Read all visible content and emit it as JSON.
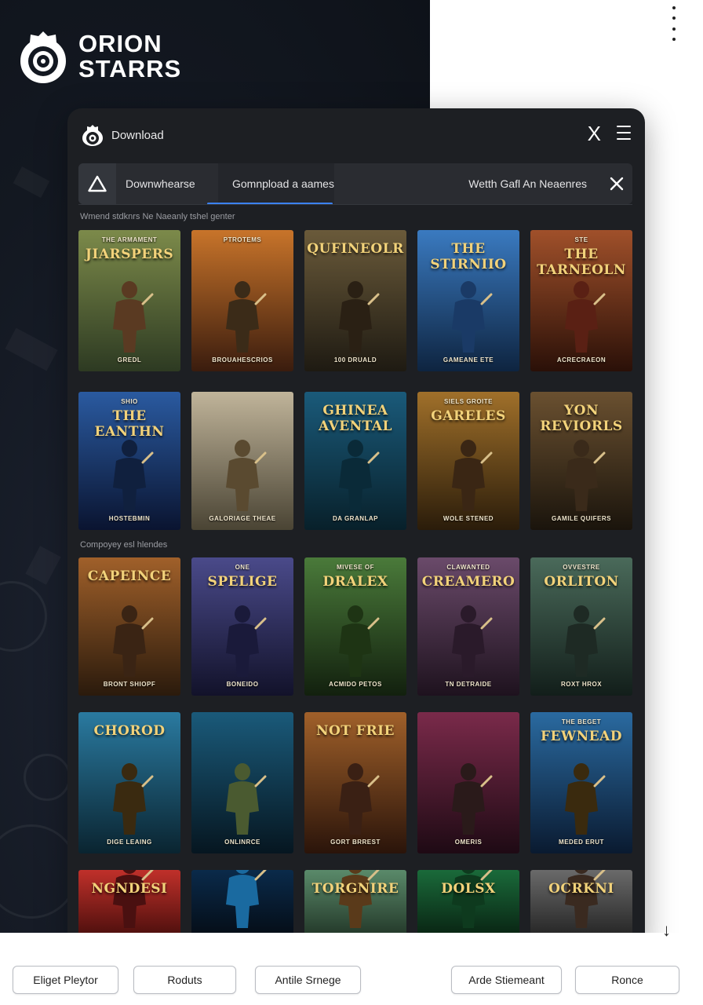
{
  "brand": {
    "line1": "ORION",
    "line2": "STARRS"
  },
  "window": {
    "title": "Download",
    "close_glyph": "X",
    "tabs": [
      {
        "label": "Downwhearse",
        "active": false
      },
      {
        "label": "Gomnpload a aames",
        "active": true
      },
      {
        "label": "Wetth Gafl An Neaenres",
        "active": false
      }
    ]
  },
  "sections": [
    {
      "label": "Wmend stdknrs  Ne Naeanly tshel genter"
    },
    {
      "label": "Compoyey esl hlendes"
    }
  ],
  "games": [
    [
      {
        "title": "JIARSPERS",
        "top": "THE ARMAMENT",
        "sub": "GREDL",
        "bg": [
          "#7c8a4a",
          "#2d3a22"
        ],
        "fig": "#5a3a22"
      },
      {
        "title": "",
        "top": "PTROTEMS",
        "sub": "BROUAHESCRIOS",
        "bg": [
          "#c8742a",
          "#3a1c0e"
        ],
        "fig": "#3b2b18"
      },
      {
        "title": "QUFINEOLR",
        "top": "",
        "sub": "100 DRUALD",
        "bg": [
          "#6a5a3a",
          "#1e1a12"
        ],
        "fig": "#2a2014"
      },
      {
        "title": "THE STIRNIIO",
        "top": "",
        "sub": "GAMEANE ETE",
        "bg": [
          "#3a7ac0",
          "#0e2440"
        ],
        "fig": "#1a3a66"
      },
      {
        "title": "THE TARNEOLN",
        "top": "STE",
        "sub": "ACRECRAEON",
        "bg": [
          "#a0502a",
          "#2a1008"
        ],
        "fig": "#5a2014"
      }
    ],
    [
      {
        "title": "THE EANTHN",
        "top": "SHIO",
        "sub": "HOSTEBMIN",
        "bg": [
          "#2a5aa0",
          "#0a1430"
        ],
        "fig": "#10203e"
      },
      {
        "title": "",
        "top": "",
        "sub": "GALORIAGE THEAE",
        "bg": [
          "#c0b49a",
          "#4a4434"
        ],
        "fig": "#5a4a30"
      },
      {
        "title": "GHINEA AVENTAL",
        "top": "",
        "sub": "DA GRANLAP",
        "bg": [
          "#1a5a7a",
          "#08202a"
        ],
        "fig": "#0a2a38"
      },
      {
        "title": "GARELES",
        "top": "SIELS GROITE",
        "sub": "WOLE STENED",
        "bg": [
          "#a0702a",
          "#2a1c0a"
        ],
        "fig": "#3a2614"
      },
      {
        "title": "YON REVIORLS",
        "top": "",
        "sub": "GAMILE QUIFERS",
        "bg": [
          "#6a5030",
          "#1a140c"
        ],
        "fig": "#3a2a1a"
      }
    ],
    [
      {
        "title": "CAPEINCE",
        "top": "",
        "sub": "BRONT SHIOPF",
        "bg": [
          "#a0602a",
          "#2a1a0c"
        ],
        "fig": "#3a2414"
      },
      {
        "title": "SPELIGE",
        "top": "ONE",
        "sub": "BONEIDO",
        "bg": [
          "#4a4a8a",
          "#12122a"
        ],
        "fig": "#1a1a3a"
      },
      {
        "title": "DRALEX",
        "top": "MIVESE OF",
        "sub": "ACMIDO PETOS",
        "bg": [
          "#4a7a3a",
          "#12200e"
        ],
        "fig": "#1e3414"
      },
      {
        "title": "CREAMERO",
        "top": "CLAWANTED",
        "sub": "TN DETRAIDE",
        "bg": [
          "#6a4a6a",
          "#1e121e"
        ],
        "fig": "#2a1a2a"
      },
      {
        "title": "ORLITON",
        "top": "OVVESTRE",
        "sub": "ROXT HROX",
        "bg": [
          "#4a6a5a",
          "#121e1a"
        ],
        "fig": "#1e2a24"
      }
    ],
    [
      {
        "title": "CHOROD",
        "top": "",
        "sub": "DIGE LEAING",
        "bg": [
          "#2a7aa0",
          "#0a2430"
        ],
        "fig": "#3a2a10"
      },
      {
        "title": "",
        "top": "",
        "sub": "ONLINRCE",
        "bg": [
          "#1a5a7a",
          "#061620"
        ],
        "fig": "#4a5a30"
      },
      {
        "title": "NOT FRIE",
        "top": "",
        "sub": "GORT BRREST",
        "bg": [
          "#a0602a",
          "#2a140a"
        ],
        "fig": "#3a2014"
      },
      {
        "title": "",
        "top": "",
        "sub": "OMERIS",
        "bg": [
          "#7a2a4a",
          "#1e0a14"
        ],
        "fig": "#2a1a1a"
      },
      {
        "title": "FEWNEAD",
        "top": "THE BEGET",
        "sub": "MEDED ERUT",
        "bg": [
          "#2a6aa0",
          "#0a1a30"
        ],
        "fig": "#3a2a0e"
      }
    ],
    [
      {
        "title": "NGNDESI",
        "top": "",
        "sub": "",
        "bg": [
          "#c0302a",
          "#3a0a08"
        ],
        "fig": "#4a1010"
      },
      {
        "title": "",
        "top": "",
        "sub": "",
        "bg": [
          "#0a2a4a",
          "#04080e"
        ],
        "fig": "#1a6aa0"
      },
      {
        "title": "TORGNIRE",
        "top": "",
        "sub": "",
        "bg": [
          "#5a8a6a",
          "#1a2a1e"
        ],
        "fig": "#5a3a1a"
      },
      {
        "title": "DOLSX",
        "top": "",
        "sub": "",
        "bg": [
          "#1a6a3a",
          "#06180c"
        ],
        "fig": "#0e3a1e"
      },
      {
        "title": "OCRKNI",
        "top": "",
        "sub": "",
        "bg": [
          "#6a6a6a",
          "#1a1a1a"
        ],
        "fig": "#3a2a20"
      }
    ]
  ],
  "bottom_buttons": [
    "Eliget Pleytor",
    "Roduts",
    "Antile Srnege",
    "Arde Stiemeant",
    "Ronce"
  ],
  "colors": {
    "accent": "#3b82f6",
    "window_bg": "#1d1f23",
    "page_bg": "#ffffff"
  },
  "icons": {
    "scroll": "arrow-down-icon",
    "close": "close-icon",
    "menu": "hamburger-icon",
    "brand": "orion-logo-icon"
  }
}
